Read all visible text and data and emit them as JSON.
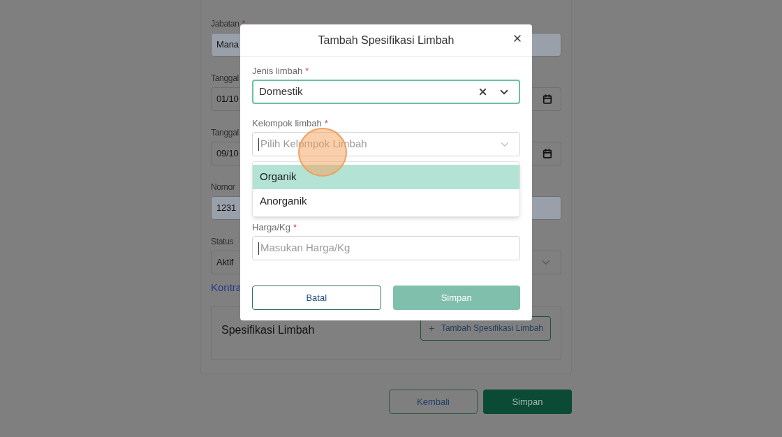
{
  "background_form": {
    "fields": [
      {
        "label": "Jabatan",
        "required_mark": "*",
        "value": "Mana",
        "kind": "text",
        "disabled": true
      },
      {
        "label": "Tanggal",
        "value": "01/10",
        "kind": "date",
        "disabled": false
      },
      {
        "label": "Tanggal",
        "value": "09/10",
        "kind": "date",
        "disabled": false
      },
      {
        "label": "Nomor",
        "value": "1231",
        "kind": "text",
        "disabled": true
      },
      {
        "label": "Status",
        "value": "Aktif",
        "kind": "select",
        "disabled": false
      }
    ],
    "link": "Kontra",
    "spec_card": {
      "title": "Spesifikasi Limbah",
      "add_button": "Tambah Spesifikasi Limbah"
    },
    "buttons": [
      {
        "label": "Kembali",
        "kind": "secondary"
      },
      {
        "label": "Simpan",
        "kind": "primary"
      }
    ]
  },
  "dialog": {
    "title": "Tambah Spesifikasi Limbah",
    "fields": [
      {
        "label": "Jenis limbah",
        "required_mark": "*",
        "kind": "select",
        "value": "Domestik",
        "focused": true
      },
      {
        "label": "Kelompok limbah",
        "required_mark": "*",
        "kind": "select",
        "placeholder": "Pilih Kelompok Limbah",
        "focused": false,
        "options": [
          {
            "label": "Organik",
            "selected": true
          },
          {
            "label": "Anorganik",
            "selected": false
          }
        ]
      },
      {
        "label": "Harga/Kg",
        "required_mark": "*",
        "kind": "text",
        "placeholder": "Masukan Harga/Kg",
        "focused": false
      }
    ],
    "buttons": [
      {
        "label": "Batal",
        "kind": "secondary"
      },
      {
        "label": "Simpan",
        "kind": "primary",
        "disabled": true
      }
    ]
  }
}
